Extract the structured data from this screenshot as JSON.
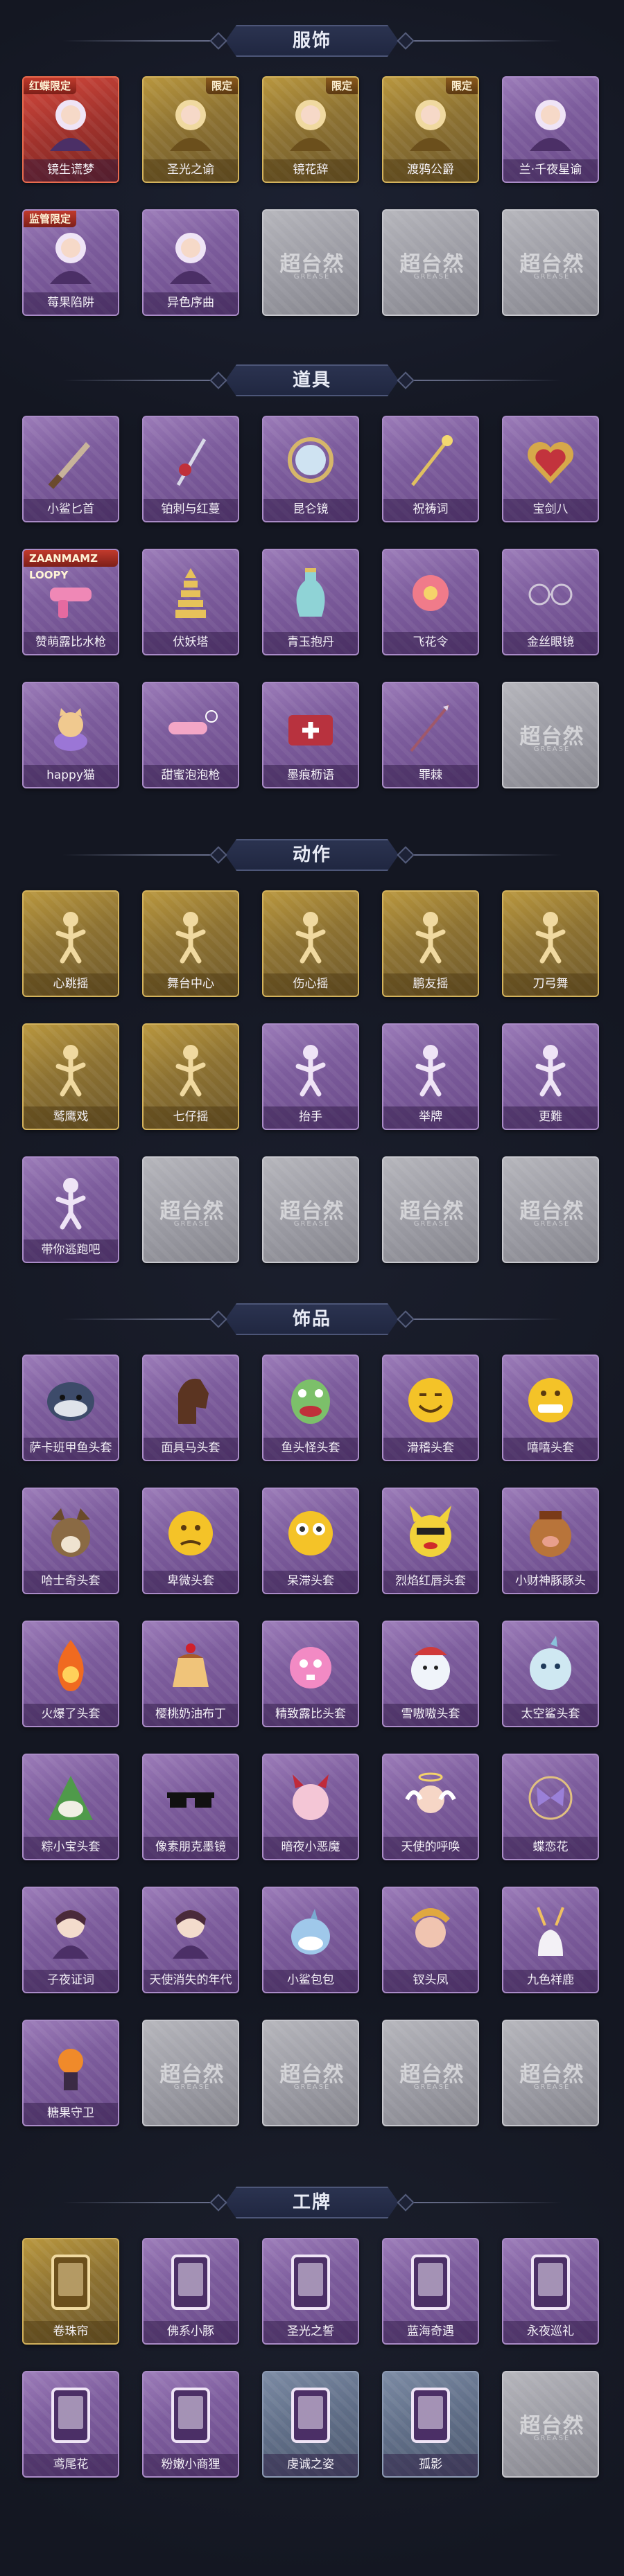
{
  "colors": {
    "background": "#141722",
    "banner": "#2b3350",
    "purple_card": "#7d5d9d",
    "gold_card": "#8d7232",
    "gray_card": "#9c9ca4"
  },
  "placeholder_watermark": {
    "main": "超台然",
    "sub": "GREASE"
  },
  "sections": [
    {
      "title": "服饰",
      "items": [
        {
          "label": "镜生谎梦",
          "style": "red",
          "icon": "costume-portrait-icon",
          "tag": "红蝶限定",
          "tag_side": "left"
        },
        {
          "label": "圣光之谕",
          "style": "gold",
          "icon": "costume-portrait-icon",
          "tag": "限定",
          "tag_side": "right"
        },
        {
          "label": "镜花辞",
          "style": "gold",
          "icon": "costume-portrait-icon",
          "tag": "限定",
          "tag_side": "right"
        },
        {
          "label": "渡鸦公爵",
          "style": "gold",
          "icon": "costume-portrait-icon",
          "tag": "限定",
          "tag_side": "right"
        },
        {
          "label": "兰·千夜星谕",
          "style": "purple",
          "icon": "costume-portrait-icon"
        },
        {
          "label": "莓果陷阱",
          "style": "purple",
          "icon": "costume-portrait-icon",
          "tag": "监管限定",
          "tag_side": "left"
        },
        {
          "label": "异色序曲",
          "style": "purple",
          "icon": "costume-portrait-icon"
        },
        {
          "label": "",
          "style": "gray",
          "icon": "empty-slot-icon"
        },
        {
          "label": "",
          "style": "gray",
          "icon": "empty-slot-icon"
        },
        {
          "label": "",
          "style": "gray",
          "icon": "empty-slot-icon"
        }
      ]
    },
    {
      "title": "道具",
      "items": [
        {
          "label": "小鲨匕首",
          "style": "purple",
          "icon": "dagger-icon"
        },
        {
          "label": "铂刺与红蔓",
          "style": "purple",
          "icon": "rose-blade-icon"
        },
        {
          "label": "昆仑镜",
          "style": "purple",
          "icon": "mirror-icon"
        },
        {
          "label": "祝祷词",
          "style": "purple",
          "icon": "scepter-icon"
        },
        {
          "label": "宝剑八",
          "style": "purple",
          "icon": "heart-frame-icon"
        },
        {
          "label": "赞萌露比水枪",
          "style": "purple",
          "icon": "water-gun-icon",
          "tag": "ZAANMAMZ LOOPY",
          "tag_side": "left"
        },
        {
          "label": "伏妖塔",
          "style": "purple",
          "icon": "pagoda-icon"
        },
        {
          "label": "青玉抱丹",
          "style": "purple",
          "icon": "vase-icon"
        },
        {
          "label": "飞花令",
          "style": "purple",
          "icon": "flower-icon"
        },
        {
          "label": "金丝眼镜",
          "style": "purple",
          "icon": "glasses-icon"
        },
        {
          "label": "happy猫",
          "style": "purple",
          "icon": "cat-icon"
        },
        {
          "label": "甜蜜泡泡枪",
          "style": "purple",
          "icon": "bubble-gun-icon"
        },
        {
          "label": "墨痕枥语",
          "style": "purple",
          "icon": "medkit-icon"
        },
        {
          "label": "罪棘",
          "style": "purple",
          "icon": "spear-icon"
        },
        {
          "label": "",
          "style": "gray",
          "icon": "empty-slot-icon"
        }
      ]
    },
    {
      "title": "动作",
      "items": [
        {
          "label": "心跳摇",
          "style": "gold",
          "icon": "pose-figure-icon"
        },
        {
          "label": "舞台中心",
          "style": "gold",
          "icon": "pose-figure-icon"
        },
        {
          "label": "伤心摇",
          "style": "gold",
          "icon": "pose-figure-icon"
        },
        {
          "label": "鹏友摇",
          "style": "gold",
          "icon": "pose-figure-icon"
        },
        {
          "label": "刀弓舞",
          "style": "gold",
          "icon": "pose-figure-icon"
        },
        {
          "label": "鹫鹰戏",
          "style": "gold",
          "icon": "pose-figure-icon"
        },
        {
          "label": "七仔摇",
          "style": "gold",
          "icon": "pose-figure-icon"
        },
        {
          "label": "抬手",
          "style": "purple",
          "icon": "pose-figure-icon"
        },
        {
          "label": "举牌",
          "style": "purple",
          "icon": "pose-figure-icon"
        },
        {
          "label": "更難",
          "style": "purple",
          "icon": "pose-figure-icon"
        },
        {
          "label": "带你逃跑吧",
          "style": "purple",
          "icon": "pose-figure-icon"
        },
        {
          "label": "",
          "style": "gray",
          "icon": "empty-slot-icon"
        },
        {
          "label": "",
          "style": "gray",
          "icon": "empty-slot-icon"
        },
        {
          "label": "",
          "style": "gray",
          "icon": "empty-slot-icon"
        },
        {
          "label": "",
          "style": "gray",
          "icon": "empty-slot-icon"
        }
      ]
    },
    {
      "title": "饰品",
      "items": [
        {
          "label": "萨卡班甲鱼头套",
          "style": "purple",
          "icon": "fish-head-icon"
        },
        {
          "label": "面具马头套",
          "style": "purple",
          "icon": "horse-head-icon"
        },
        {
          "label": "鱼头怪头套",
          "style": "purple",
          "icon": "fish-monster-icon"
        },
        {
          "label": "滑稽头套",
          "style": "purple",
          "icon": "smile-face-icon"
        },
        {
          "label": "嘻嘻头套",
          "style": "purple",
          "icon": "grin-face-icon"
        },
        {
          "label": "哈士奇头套",
          "style": "purple",
          "icon": "husky-icon"
        },
        {
          "label": "卑微头套",
          "style": "purple",
          "icon": "sad-face-icon"
        },
        {
          "label": "呆滞头套",
          "style": "purple",
          "icon": "stare-face-icon"
        },
        {
          "label": "烈焰红唇头套",
          "style": "purple",
          "icon": "pikachu-icon"
        },
        {
          "label": "小财神豚豚头",
          "style": "purple",
          "icon": "pig-icon"
        },
        {
          "label": "火爆了头套",
          "style": "purple",
          "icon": "fire-icon"
        },
        {
          "label": "樱桃奶油布丁",
          "style": "purple",
          "icon": "pudding-icon"
        },
        {
          "label": "精致露比头套",
          "style": "purple",
          "icon": "pink-beaver-icon"
        },
        {
          "label": "雪嗷嗷头套",
          "style": "purple",
          "icon": "snowman-icon"
        },
        {
          "label": "太空鲨头套",
          "style": "purple",
          "icon": "space-shark-icon"
        },
        {
          "label": "粽小宝头套",
          "style": "purple",
          "icon": "zongzi-icon"
        },
        {
          "label": "像素朋克墨镜",
          "style": "purple",
          "icon": "pixel-glasses-icon"
        },
        {
          "label": "暗夜小恶魔",
          "style": "purple",
          "icon": "devil-icon"
        },
        {
          "label": "天使的呼唤",
          "style": "purple",
          "icon": "angel-icon"
        },
        {
          "label": "蝶恋花",
          "style": "purple",
          "icon": "butterfly-icon"
        },
        {
          "label": "子夜证词",
          "style": "purple",
          "icon": "doll-icon"
        },
        {
          "label": "天使消失的年代",
          "style": "purple",
          "icon": "doll-icon"
        },
        {
          "label": "小鲨包包",
          "style": "purple",
          "icon": "shark-bag-icon"
        },
        {
          "label": "钗头凤",
          "style": "purple",
          "icon": "phoenix-icon"
        },
        {
          "label": "九色祥鹿",
          "style": "purple",
          "icon": "deer-icon"
        },
        {
          "label": "糖果守卫",
          "style": "purple",
          "icon": "candy-guard-icon"
        },
        {
          "label": "",
          "style": "gray",
          "icon": "empty-slot-icon"
        },
        {
          "label": "",
          "style": "gray",
          "icon": "empty-slot-icon"
        },
        {
          "label": "",
          "style": "gray",
          "icon": "empty-slot-icon"
        },
        {
          "label": "",
          "style": "gray",
          "icon": "empty-slot-icon"
        }
      ]
    },
    {
      "title": "工牌",
      "items": [
        {
          "label": "卷珠帘",
          "style": "gold",
          "icon": "badge-card-icon"
        },
        {
          "label": "佛系小豚",
          "style": "purple",
          "icon": "badge-card-icon"
        },
        {
          "label": "圣光之誓",
          "style": "purple",
          "icon": "badge-card-icon"
        },
        {
          "label": "蓝海奇遇",
          "style": "purple",
          "icon": "badge-card-icon"
        },
        {
          "label": "永夜巡礼",
          "style": "purple",
          "icon": "badge-card-icon"
        },
        {
          "label": "鸢尾花",
          "style": "purple",
          "icon": "badge-card-icon"
        },
        {
          "label": "粉嫩小商狸",
          "style": "purple",
          "icon": "badge-card-icon"
        },
        {
          "label": "虔诚之姿",
          "style": "slate",
          "icon": "badge-card-icon"
        },
        {
          "label": "孤影",
          "style": "slate",
          "icon": "badge-card-icon"
        },
        {
          "label": "",
          "style": "gray",
          "icon": "empty-slot-icon"
        }
      ]
    }
  ]
}
